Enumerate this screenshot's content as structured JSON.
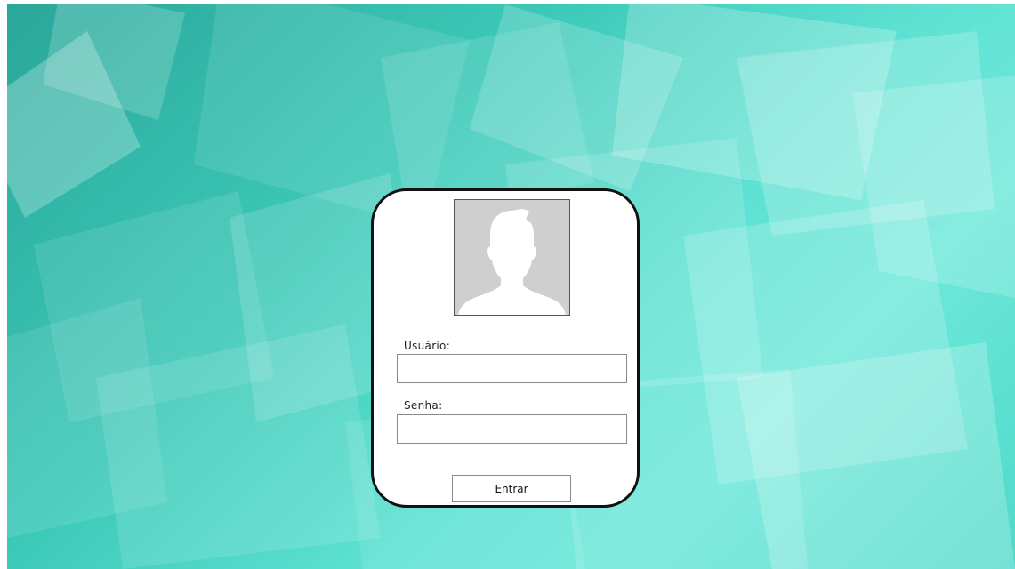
{
  "login": {
    "avatar_icon": "user-silhouette-icon",
    "username_label": "Usuário:",
    "username_value": "",
    "password_label": "Senha:",
    "password_value": "",
    "submit_label": "Entrar"
  },
  "colors": {
    "background_dark": "#2aa79a",
    "background_light": "#6de8da",
    "card_border": "#111111",
    "avatar_bg": "#cfcfcf",
    "silhouette": "#ffffff"
  }
}
